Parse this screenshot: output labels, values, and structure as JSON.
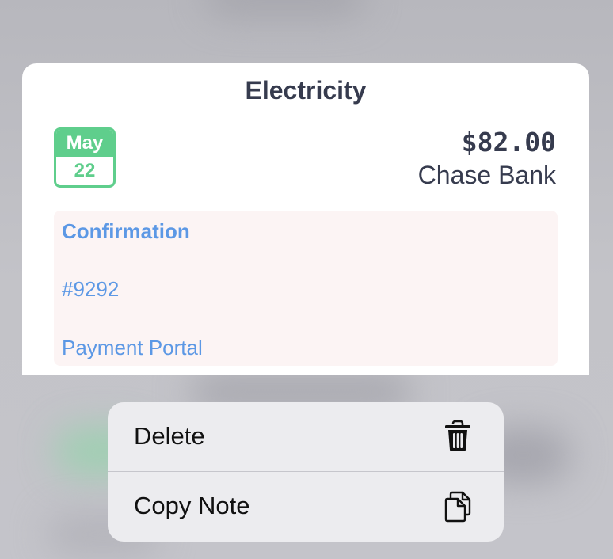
{
  "card": {
    "title": "Electricity",
    "date": {
      "month": "May",
      "day": "22"
    },
    "amount": "$82.00",
    "payee": "Chase Bank",
    "note": {
      "heading": "Confirmation",
      "number": "#9292",
      "link": "Payment Portal"
    }
  },
  "menu": {
    "items": [
      {
        "label": "Delete",
        "icon": "trash-icon"
      },
      {
        "label": "Copy Note",
        "icon": "copy-documents-icon"
      }
    ]
  },
  "colors": {
    "accent_green": "#5fce8c",
    "link_blue": "#5c98e5",
    "text_dark": "#363b4e",
    "note_background": "#fcf4f4",
    "menu_background": "#ececef"
  }
}
